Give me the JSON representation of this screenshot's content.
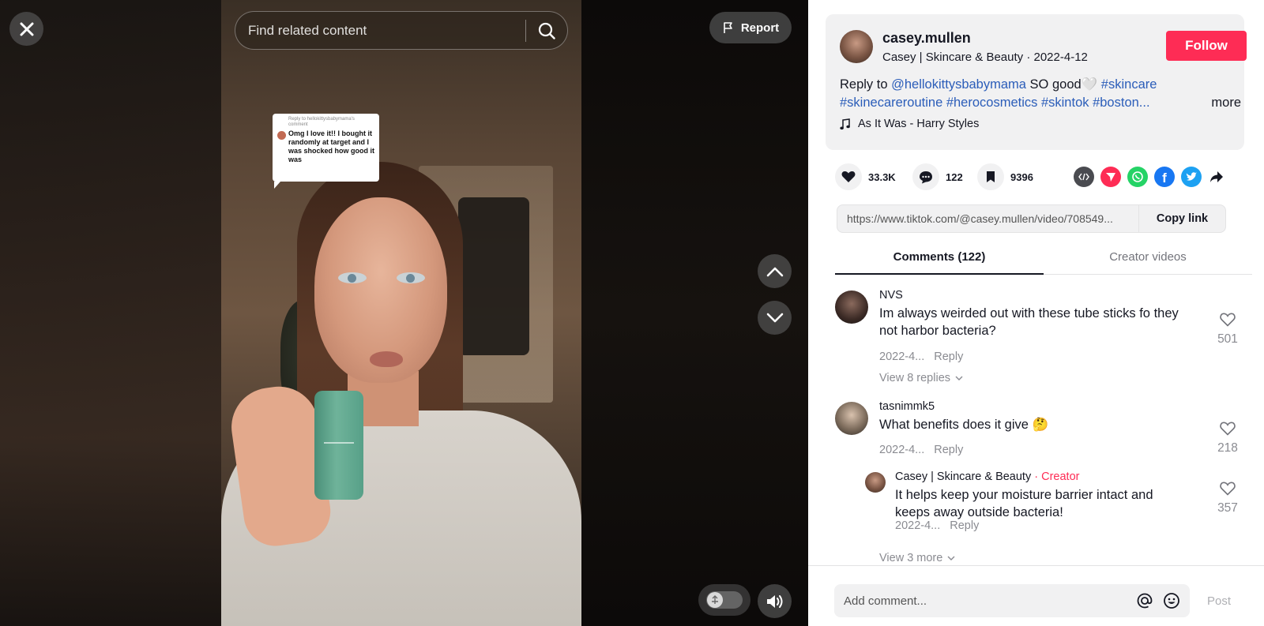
{
  "video": {
    "search_placeholder": "Find related content",
    "report_label": "Report",
    "reply_bubble": {
      "header": "Reply to hellokittysbabymama's comment",
      "text": "Omg I love it!! I bought it randomly at target and I was shocked how good it was"
    }
  },
  "author": {
    "username": "casey.mullen",
    "display_name": "Casey | Skincare & Beauty",
    "date": "2022-4-12",
    "follow_label": "Follow"
  },
  "caption": {
    "prefix": "Reply to ",
    "mention": "@hellokittysbabymama",
    "body": " SO good🤍 ",
    "hashtags_line1": "#skincare",
    "hashtags_line2": "#skinecareroutine #herocosmetics #skintok #boston...",
    "more_label": "more"
  },
  "music": {
    "title": "As It Was - Harry Styles",
    "icon": "music-note-icon"
  },
  "stats": {
    "likes": "33.3K",
    "comments": "122",
    "saves": "9396"
  },
  "share_icons": [
    "embed-icon",
    "send-to-friends-icon",
    "whatsapp-icon",
    "facebook-icon",
    "twitter-icon",
    "share-arrow-icon"
  ],
  "colors": {
    "accent": "#fe2c55",
    "link": "#2b5db9",
    "whatsapp": "#25d366",
    "facebook": "#1877f2",
    "twitter": "#1da1f2",
    "embed": "#4a4b50"
  },
  "link": {
    "url": "https://www.tiktok.com/@casey.mullen/video/708549...",
    "copy_label": "Copy link"
  },
  "tabs": [
    {
      "label": "Comments (122)",
      "active": true
    },
    {
      "label": "Creator videos",
      "active": false
    }
  ],
  "comments": [
    {
      "username": "NVS",
      "text": "Im always weirded out with these tube sticks fo they not harbor bacteria?",
      "date": "2022-4...",
      "reply_label": "Reply",
      "likes": "501",
      "view_replies": "View 8 replies"
    },
    {
      "username": "tasnimmk5",
      "text": "What benefits does it give 🤔",
      "date": "2022-4...",
      "reply_label": "Reply",
      "likes": "218"
    },
    {
      "username": "Casey | Skincare & Beauty",
      "creator_tag": "· Creator",
      "text": "It helps keep your moisture barrier intact and keeps away outside bacteria!",
      "date": "2022-4...",
      "reply_label": "Reply",
      "likes": "357",
      "view_replies": "View 3 more"
    }
  ],
  "comment_bar": {
    "placeholder": "Add comment...",
    "post_label": "Post"
  }
}
